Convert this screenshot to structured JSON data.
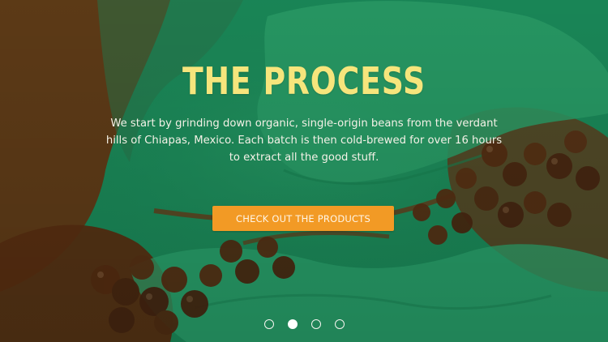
{
  "hero": {
    "title": "THE PROCESS",
    "description": "We start by grinding down organic, single-origin beans from the verdant hills of Chiapas, Mexico. Each batch is then cold-brewed for over 16 hours to extract all the good stuff.",
    "cta_label": "CHECK OUT THE PRODUCTS",
    "background_subject": "hands holding coffee cherries"
  },
  "carousel": {
    "slide_count": 4,
    "active_slide": 2,
    "dots": [
      {
        "label": "slide 1"
      },
      {
        "label": "slide 2"
      },
      {
        "label": "slide 3"
      },
      {
        "label": "slide 4"
      }
    ]
  },
  "colors": {
    "overlay_green": "#1f9a63",
    "dark_brown": "#6f3a12",
    "title_yellow": "#f6e57c",
    "button_orange": "#f29a25",
    "text_light": "#f3f1e6"
  }
}
